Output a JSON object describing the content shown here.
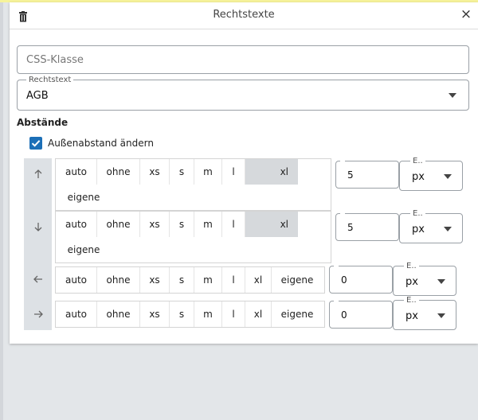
{
  "dialog": {
    "title": "Rechtstexte",
    "close_glyph": "×"
  },
  "css_class": {
    "placeholder": "CSS-Klasse",
    "value": ""
  },
  "rechtstext": {
    "label": "Rechtstext",
    "value": "AGB"
  },
  "abstaende": {
    "title": "Abstände",
    "checkbox_label": "Außenabstand ändern",
    "checkbox_checked": true
  },
  "spacing_rows": [
    {
      "direction_icon": "arrow-up-icon",
      "options": [
        "auto",
        "ohne",
        "xs",
        "s",
        "m",
        "l",
        "xl"
      ],
      "custom_label": "eigene",
      "selected": "xl",
      "value": "5",
      "unit_label": "E..",
      "unit": "px"
    },
    {
      "direction_icon": "arrow-down-icon",
      "options": [
        "auto",
        "ohne",
        "xs",
        "s",
        "m",
        "l",
        "xl"
      ],
      "custom_label": "eigene",
      "selected": "xl",
      "value": "5",
      "unit_label": "E..",
      "unit": "px"
    },
    {
      "direction_icon": "arrow-left-icon",
      "options": [
        "auto",
        "ohne",
        "xs",
        "s",
        "m",
        "l",
        "xl",
        "eigene"
      ],
      "selected": "",
      "value": "0",
      "unit_label": "E..",
      "unit": "px"
    },
    {
      "direction_icon": "arrow-right-icon",
      "options": [
        "auto",
        "ohne",
        "xs",
        "s",
        "m",
        "l",
        "xl",
        "eigene"
      ],
      "selected": "",
      "value": "0",
      "unit_label": "E..",
      "unit": "px"
    }
  ],
  "colors": {
    "accent": "#1c6fb7",
    "selected_segment": "#d6d9dc",
    "background": "#e3e6e9"
  }
}
